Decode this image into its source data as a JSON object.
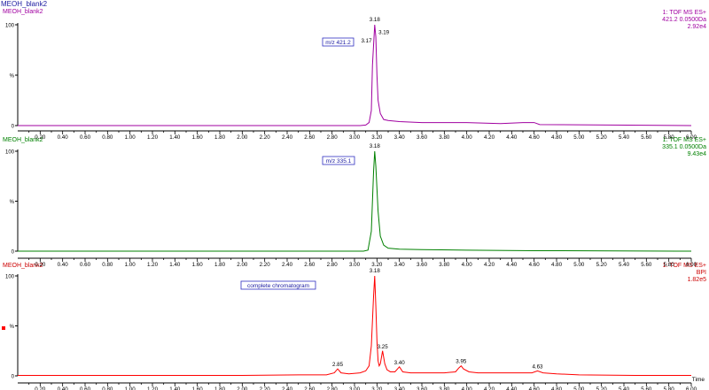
{
  "app_title": "MEOH_blank2",
  "x_axis_label": "Time",
  "x_ticks": [
    "0.20",
    "0.40",
    "0.60",
    "0.80",
    "1.00",
    "1.20",
    "1.40",
    "1.60",
    "1.80",
    "2.00",
    "2.20",
    "2.40",
    "2.60",
    "2.80",
    "3.00",
    "3.20",
    "3.40",
    "3.60",
    "3.80",
    "4.00",
    "4.20",
    "4.40",
    "4.60",
    "4.80",
    "5.00",
    "5.20",
    "5.40",
    "5.60",
    "5.80",
    "6.00"
  ],
  "y_ticks": [
    "100",
    "%",
    "0"
  ],
  "chart_data": [
    {
      "type": "line",
      "sample": "MEOH_blank2",
      "color": "#a000a0",
      "info": [
        "1: TOF MS ES+",
        "421.2 0.0500Da",
        "2.92e4"
      ],
      "annotation": "m/z 421.2",
      "xlim": [
        0.0,
        6.0
      ],
      "ylim": [
        0,
        100
      ],
      "peak_labels": [
        {
          "label": "3.18",
          "x": 3.18,
          "y": 100
        },
        {
          "label": "3.17",
          "x": 3.17,
          "y": 80
        },
        {
          "label": "3.19",
          "x": 3.19,
          "y": 88
        }
      ],
      "x": [
        0.0,
        1.5,
        3.05,
        3.1,
        3.13,
        3.15,
        3.16,
        3.17,
        3.18,
        3.19,
        3.2,
        3.21,
        3.23,
        3.26,
        3.3,
        3.4,
        3.6,
        3.8,
        4.0,
        4.3,
        4.5,
        4.6,
        4.65,
        6.0
      ],
      "y": [
        0,
        0,
        0,
        0.5,
        3,
        15,
        60,
        80,
        100,
        88,
        50,
        25,
        12,
        6,
        5,
        4,
        3,
        3,
        3,
        2,
        3,
        3,
        1,
        0
      ]
    },
    {
      "type": "line",
      "sample": "MEOH_blank2",
      "color": "#008000",
      "info": [
        "1: TOF MS ES+",
        "335.1 0.0500Da",
        "9.43e4"
      ],
      "annotation": "m/z 335.1",
      "xlim": [
        0.0,
        6.0
      ],
      "ylim": [
        0,
        100
      ],
      "peak_labels": [
        {
          "label": "3.18",
          "x": 3.18,
          "y": 100
        }
      ],
      "x": [
        0.0,
        3.08,
        3.12,
        3.15,
        3.17,
        3.18,
        3.19,
        3.21,
        3.23,
        3.26,
        3.3,
        3.4,
        3.6,
        4.0,
        4.6,
        6.0
      ],
      "y": [
        0,
        0,
        1,
        20,
        80,
        100,
        85,
        40,
        15,
        6,
        3,
        2,
        1.5,
        1,
        0.5,
        0
      ]
    },
    {
      "type": "line",
      "sample": "MEOH_blank2",
      "color": "#ff0000",
      "info": [
        "1: TOF MS ES+",
        "BPI",
        "1.82e5"
      ],
      "annotation": "complete chromatogram",
      "xlim": [
        0.0,
        6.0
      ],
      "ylim": [
        0,
        100
      ],
      "peak_labels": [
        {
          "label": "3.18",
          "x": 3.18,
          "y": 100
        },
        {
          "label": "2.85",
          "x": 2.85,
          "y": 7
        },
        {
          "label": "3.25",
          "x": 3.25,
          "y": 25
        },
        {
          "label": "3.40",
          "x": 3.4,
          "y": 9
        },
        {
          "label": "3.95",
          "x": 3.95,
          "y": 10
        },
        {
          "label": "4.63",
          "x": 4.63,
          "y": 5
        }
      ],
      "x": [
        0.0,
        0.5,
        1.0,
        1.5,
        2.0,
        2.5,
        2.75,
        2.82,
        2.85,
        2.88,
        2.95,
        3.05,
        3.1,
        3.13,
        3.15,
        3.17,
        3.18,
        3.19,
        3.2,
        3.21,
        3.22,
        3.23,
        3.25,
        3.27,
        3.29,
        3.32,
        3.36,
        3.4,
        3.43,
        3.5,
        3.6,
        3.7,
        3.8,
        3.9,
        3.93,
        3.95,
        3.97,
        4.02,
        4.1,
        4.3,
        4.5,
        4.58,
        4.63,
        4.68,
        4.8,
        5.0,
        5.5,
        6.0
      ],
      "y": [
        0.5,
        0.5,
        0.5,
        0.5,
        0.5,
        1,
        1,
        3,
        7,
        3,
        2,
        3,
        5,
        10,
        30,
        80,
        100,
        70,
        35,
        15,
        10,
        12,
        25,
        12,
        6,
        4,
        4,
        9,
        4,
        3,
        3,
        3,
        3,
        4,
        8,
        10,
        7,
        4,
        3,
        3,
        3,
        3,
        5,
        3,
        2,
        1,
        0.5,
        0.5
      ]
    }
  ]
}
